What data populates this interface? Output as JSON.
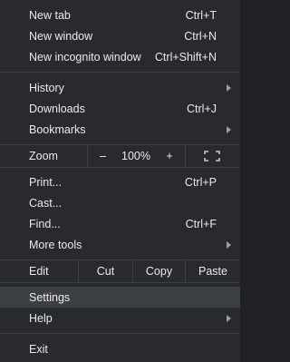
{
  "menu": {
    "new_tab": {
      "label": "New tab",
      "shortcut": "Ctrl+T"
    },
    "new_window": {
      "label": "New window",
      "shortcut": "Ctrl+N"
    },
    "new_incognito": {
      "label": "New incognito window",
      "shortcut": "Ctrl+Shift+N"
    },
    "history": {
      "label": "History"
    },
    "downloads": {
      "label": "Downloads",
      "shortcut": "Ctrl+J"
    },
    "bookmarks": {
      "label": "Bookmarks"
    },
    "zoom": {
      "label": "Zoom",
      "minus": "–",
      "level": "100%",
      "plus": "+"
    },
    "print": {
      "label": "Print...",
      "shortcut": "Ctrl+P"
    },
    "cast": {
      "label": "Cast..."
    },
    "find": {
      "label": "Find...",
      "shortcut": "Ctrl+F"
    },
    "more_tools": {
      "label": "More tools"
    },
    "edit": {
      "label": "Edit",
      "cut": "Cut",
      "copy": "Copy",
      "paste": "Paste"
    },
    "settings": {
      "label": "Settings"
    },
    "help": {
      "label": "Help"
    },
    "exit": {
      "label": "Exit"
    }
  },
  "colors": {
    "background": "#292a2d",
    "hover": "#3c4043",
    "text": "#e8eaed",
    "separator": "#3c4043"
  }
}
